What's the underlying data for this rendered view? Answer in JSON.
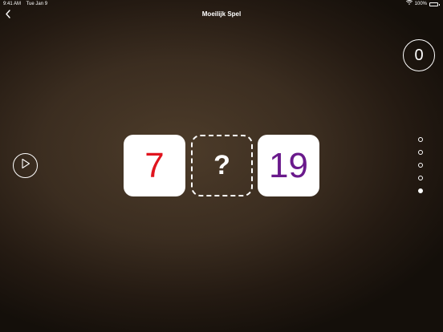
{
  "status_bar": {
    "time": "9:41 AM",
    "date": "Tue Jan 9",
    "battery": "100%",
    "wifi_icon": "wifi-icon",
    "battery_icon": "battery-icon"
  },
  "nav": {
    "back_icon": "chevron-left-icon",
    "title": "Moeilijk Spel"
  },
  "score": {
    "value": "0"
  },
  "play_icon": "play-icon",
  "puzzle": {
    "left": {
      "text": "7",
      "color": "#e0141e"
    },
    "middle": {
      "text": "?"
    },
    "right": {
      "text": "19",
      "color": "#6a1a8c"
    }
  },
  "pagination": {
    "total": 5,
    "active_index": 4
  }
}
